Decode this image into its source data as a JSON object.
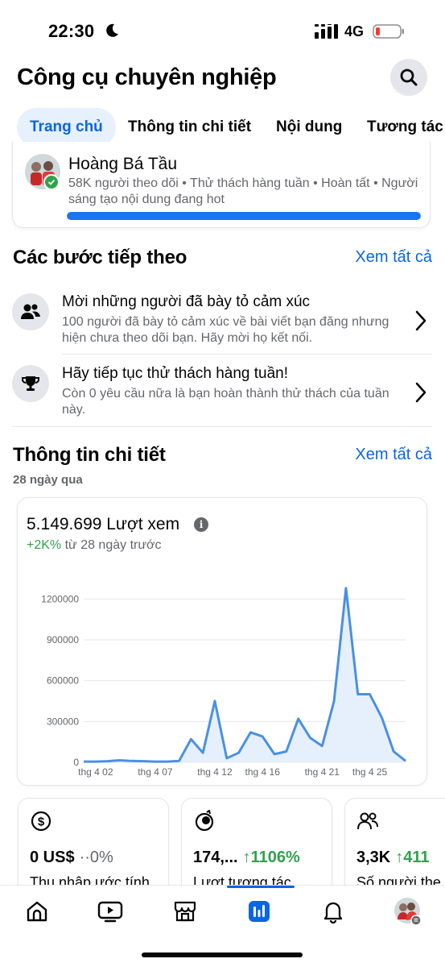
{
  "status_bar": {
    "time": "22:30",
    "network": "4G"
  },
  "header": {
    "title": "Công cụ chuyên nghiệp",
    "search_icon": "search-icon"
  },
  "tabs": [
    {
      "label": "Trang chủ",
      "active": true
    },
    {
      "label": "Thông tin chi tiết",
      "active": false
    },
    {
      "label": "Nội dung",
      "active": false
    },
    {
      "label": "Tương tác",
      "active": false
    }
  ],
  "profile": {
    "name": "Hoàng Bá Tầu",
    "meta": "58K người theo dõi • Thử thách hàng tuần • Hoàn tất • Người sáng tạo nội dung đang hot",
    "progress": 1.0
  },
  "next_steps": {
    "title": "Các bước tiếp theo",
    "see_all": "Xem tất cả",
    "items": [
      {
        "icon": "people-icon",
        "title": "Mời những người đã bày tỏ cảm xúc",
        "desc": "100 người đã bày tỏ cảm xúc về bài viết bạn đăng nhưng hiện chưa theo dõi bạn. Hãy mời họ kết nối."
      },
      {
        "icon": "trophy-icon",
        "title": "Hãy tiếp tục thử thách hàng tuần!",
        "desc": "Còn 0 yêu cầu nữa là bạn hoàn thành thử thách của tuần này."
      }
    ]
  },
  "insights": {
    "title": "Thông tin chi tiết",
    "see_all": "Xem tất cả",
    "period": "28 ngày qua",
    "metric_value": "5.149.699 Lượt xem",
    "change_pos": "+2K%",
    "change_rest": " từ 28 ngày trước"
  },
  "chart_data": {
    "type": "area",
    "x_tick_labels": [
      "thg 4 02",
      "thg 4 07",
      "thg 4 12",
      "thg 4 16",
      "thg 4 21",
      "thg 4 25"
    ],
    "y_ticks": [
      "0",
      "300000",
      "600000",
      "900000",
      "1200000"
    ],
    "ylim": [
      0,
      1350000
    ],
    "values": [
      5000,
      5000,
      8000,
      15000,
      10000,
      8000,
      5000,
      5000,
      10000,
      170000,
      70000,
      450000,
      30000,
      70000,
      220000,
      190000,
      60000,
      80000,
      320000,
      180000,
      120000,
      450000,
      1280000,
      500000,
      500000,
      330000,
      80000,
      10000
    ],
    "series_color": "#4a90e2",
    "fill_color": "#e6f0fc",
    "grid": true
  },
  "stats": [
    {
      "icon": "dollar-icon",
      "value": "0 US$",
      "change": "··0%",
      "trend": "flat",
      "label": "Thu nhập ước tính"
    },
    {
      "icon": "engagement-icon",
      "value": "174,...",
      "change": "↑1106%",
      "trend": "up",
      "label": "Lượt tương tác"
    },
    {
      "icon": "followers-icon",
      "value": "3,3K",
      "change": "↑411",
      "trend": "up",
      "label": "Số người the"
    }
  ],
  "bottom_nav": [
    {
      "icon": "home-icon",
      "active": false
    },
    {
      "icon": "video-icon",
      "active": false
    },
    {
      "icon": "marketplace-icon",
      "active": false
    },
    {
      "icon": "professional-dashboard-icon",
      "active": true
    },
    {
      "icon": "bell-icon",
      "active": false
    },
    {
      "icon": "profile-avatar",
      "active": false
    }
  ]
}
